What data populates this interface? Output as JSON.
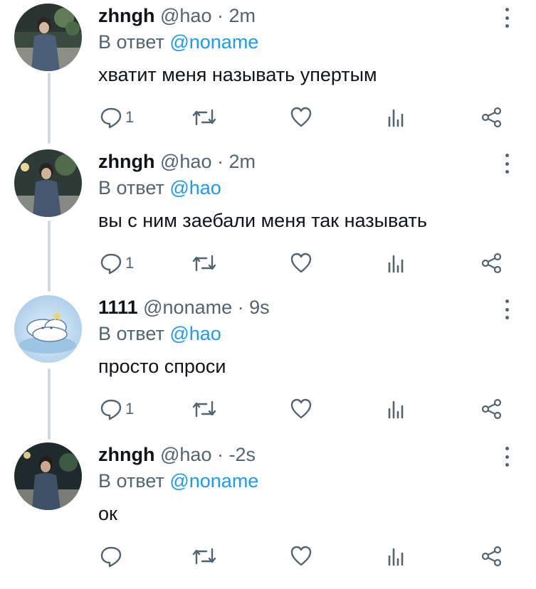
{
  "tweets": [
    {
      "name": "zhngh",
      "handle": "@hao",
      "time": "2m",
      "reply_prefix": "В ответ",
      "reply_to": "@noname",
      "text": "хватит меня называть упертым",
      "reply_count": "1",
      "avatar": "person-night-photo"
    },
    {
      "name": "zhngh",
      "handle": "@hao",
      "time": "2m",
      "reply_prefix": "В ответ",
      "reply_to": "@hao",
      "text": "вы с ним заебали меня так называть",
      "reply_count": "1",
      "avatar": "person-night-photo"
    },
    {
      "name": "1111",
      "handle": "@noname",
      "time": "9s",
      "reply_prefix": "В ответ",
      "reply_to": "@hao",
      "text": "просто спроси",
      "reply_count": "1",
      "avatar": "cloud-illustration"
    },
    {
      "name": "zhngh",
      "handle": "@hao",
      "time": "-2s",
      "reply_prefix": "В ответ",
      "reply_to": "@noname",
      "text": "ок",
      "reply_count": "",
      "avatar": "person-night-photo"
    }
  ],
  "separator": "·",
  "icons": {
    "reply": "speech-bubble-icon",
    "retweet": "retweet-icon",
    "like": "heart-icon",
    "views": "bar-chart-icon",
    "share": "share-icon",
    "more": "vertical-dots-icon"
  },
  "colors": {
    "text": "#0f1419",
    "secondary": "#536471",
    "mention": "#1d9bf0",
    "thread_line": "#cfd9de"
  }
}
